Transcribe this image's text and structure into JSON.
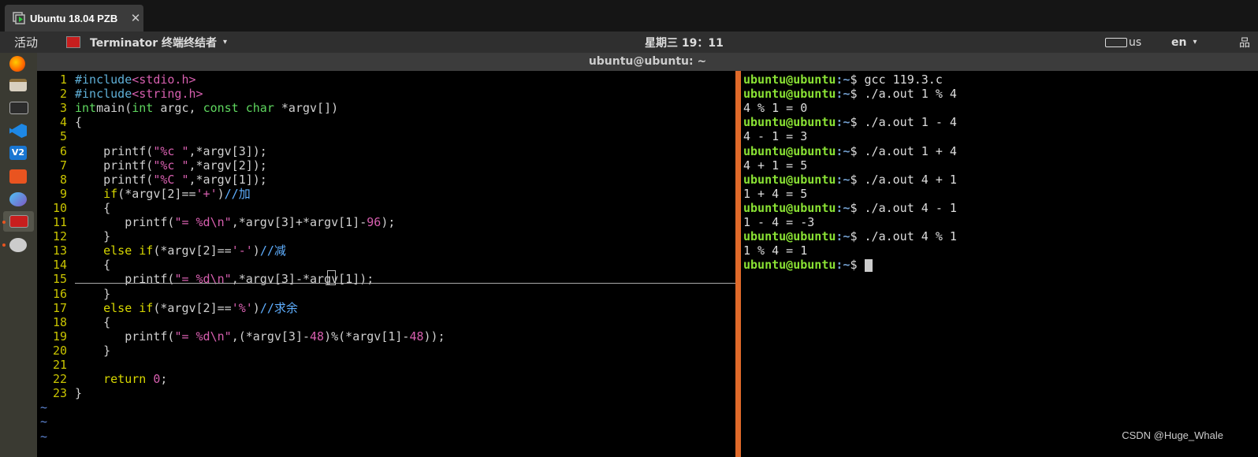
{
  "vm": {
    "tab_title": "Ubuntu 18.04 PZB",
    "close_glyph": "✕"
  },
  "top_bar": {
    "activities": "活动",
    "app_name": "Terminator 终端终结者",
    "clock": "星期三 19：11",
    "kbd_layout": "us",
    "lang": "en",
    "caret": "▾",
    "net_glyph": "品"
  },
  "window": {
    "title": "ubuntu@ubuntu: ~"
  },
  "editor": {
    "lines": [
      {
        "n": "1",
        "segs": [
          [
            "c-pre",
            "#include"
          ],
          [
            "c-inc",
            "<stdio.h>"
          ]
        ]
      },
      {
        "n": "2",
        "segs": [
          [
            "c-pre",
            "#include"
          ],
          [
            "c-inc",
            "<string.h>"
          ]
        ]
      },
      {
        "n": "3",
        "segs": [
          [
            "c-type",
            "int"
          ],
          [
            "",
            "main("
          ],
          [
            "c-type",
            "int"
          ],
          [
            "",
            " argc, "
          ],
          [
            "c-type",
            "const char"
          ],
          [
            "",
            " *argv[])"
          ]
        ]
      },
      {
        "n": "4",
        "segs": [
          [
            "",
            "{"
          ]
        ]
      },
      {
        "n": "5",
        "segs": [
          [
            "",
            ""
          ]
        ]
      },
      {
        "n": "6",
        "segs": [
          [
            "",
            "    printf("
          ],
          [
            "c-str",
            "\"%c \""
          ],
          [
            "",
            ",*argv[3]);"
          ]
        ]
      },
      {
        "n": "7",
        "segs": [
          [
            "",
            "    printf("
          ],
          [
            "c-str",
            "\"%c \""
          ],
          [
            "",
            ",*argv[2]);"
          ]
        ]
      },
      {
        "n": "8",
        "segs": [
          [
            "",
            "    printf("
          ],
          [
            "c-str",
            "\"%C \""
          ],
          [
            "",
            ",*argv[1]);"
          ]
        ]
      },
      {
        "n": "9",
        "segs": [
          [
            "c-kw",
            "    if"
          ],
          [
            "",
            "(*argv[2]=="
          ],
          [
            "c-str",
            "'+'"
          ],
          [
            "",
            ")"
          ],
          [
            "c-cmt",
            "//加"
          ]
        ]
      },
      {
        "n": "10",
        "segs": [
          [
            "",
            "    {"
          ]
        ]
      },
      {
        "n": "11",
        "segs": [
          [
            "",
            "       printf("
          ],
          [
            "c-str",
            "\"= %d\\n\""
          ],
          [
            "",
            ",*argv[3]+*argv[1]-"
          ],
          [
            "c-num",
            "96"
          ],
          [
            "",
            ");"
          ]
        ]
      },
      {
        "n": "12",
        "segs": [
          [
            "",
            "    }"
          ]
        ]
      },
      {
        "n": "13",
        "segs": [
          [
            "c-kw",
            "    else if"
          ],
          [
            "",
            "(*argv[2]=="
          ],
          [
            "c-str",
            "'-'"
          ],
          [
            "",
            ")"
          ],
          [
            "c-cmt",
            "//减"
          ]
        ]
      },
      {
        "n": "14",
        "segs": [
          [
            "",
            "    {"
          ]
        ]
      },
      {
        "n": "15",
        "segs": [
          [
            "",
            "       printf("
          ],
          [
            "c-str",
            "\"= %d\\n\""
          ],
          [
            "",
            ",*argv[3]-*argv[1]);"
          ]
        ]
      },
      {
        "n": "16",
        "segs": [
          [
            "",
            "    }"
          ]
        ]
      },
      {
        "n": "17",
        "segs": [
          [
            "c-kw",
            "    else if"
          ],
          [
            "",
            "(*argv[2]=="
          ],
          [
            "c-str",
            "'%'"
          ],
          [
            "",
            ")"
          ],
          [
            "c-cmt",
            "//求余"
          ]
        ]
      },
      {
        "n": "18",
        "segs": [
          [
            "",
            "    {"
          ]
        ]
      },
      {
        "n": "19",
        "segs": [
          [
            "",
            "       printf("
          ],
          [
            "c-str",
            "\"= %d\\n\""
          ],
          [
            "",
            ",(*argv[3]-"
          ],
          [
            "c-num",
            "48"
          ],
          [
            "",
            ")%(*argv[1]-"
          ],
          [
            "c-num",
            "48"
          ],
          [
            "",
            "));"
          ]
        ]
      },
      {
        "n": "20",
        "segs": [
          [
            "",
            "    }"
          ]
        ]
      },
      {
        "n": "21",
        "segs": [
          [
            "",
            ""
          ]
        ]
      },
      {
        "n": "22",
        "segs": [
          [
            "c-kw",
            "    return"
          ],
          [
            "",
            " "
          ],
          [
            "c-num",
            "0"
          ],
          [
            "",
            ";"
          ]
        ]
      },
      {
        "n": "23",
        "segs": [
          [
            "",
            "}"
          ]
        ]
      }
    ],
    "tildes": [
      "~",
      "~",
      "~"
    ]
  },
  "terminal": {
    "prompt_user": "ubuntu@ubuntu",
    "prompt_path": ":~",
    "prompt_sym": "$ ",
    "lines": [
      {
        "type": "cmd",
        "text": "gcc 119.3.c"
      },
      {
        "type": "cmd",
        "text": "./a.out 1 % 4"
      },
      {
        "type": "out",
        "text": "4 % 1 = 0"
      },
      {
        "type": "cmd",
        "text": "./a.out 1 - 4"
      },
      {
        "type": "out",
        "text": "4 - 1 = 3"
      },
      {
        "type": "cmd",
        "text": "./a.out 1 + 4"
      },
      {
        "type": "out",
        "text": "4 + 1 = 5"
      },
      {
        "type": "cmd",
        "text": "./a.out 4 + 1"
      },
      {
        "type": "out",
        "text": "1 + 4 = 5"
      },
      {
        "type": "cmd",
        "text": "./a.out 4 - 1"
      },
      {
        "type": "out",
        "text": "1 - 4 = -3"
      },
      {
        "type": "cmd",
        "text": "./a.out 4 % 1"
      },
      {
        "type": "out",
        "text": "1 % 4 = 1"
      },
      {
        "type": "prompt",
        "text": ""
      }
    ]
  },
  "dock_icons": [
    "firefox-icon",
    "files-icon",
    "terminal-icon",
    "vscode-icon",
    "v2ray-icon",
    "software-center-icon",
    "network-tool-icon",
    "terminator-icon",
    "settings-icon"
  ],
  "watermark": "CSDN @Huge_Whale"
}
